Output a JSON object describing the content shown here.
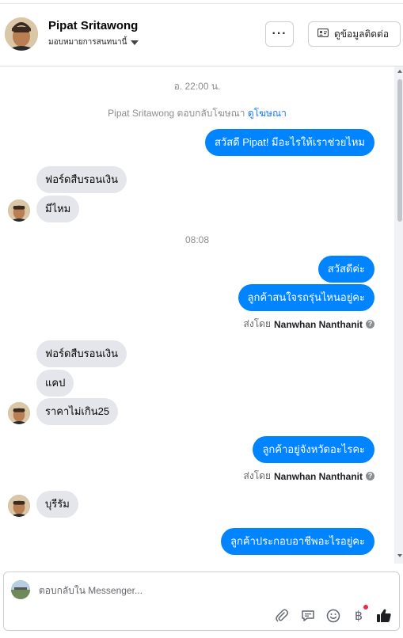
{
  "header": {
    "contact_name": "Pipat Sritawong",
    "assign_label": "มอบหมายการสนทนานี้",
    "more_label": "···",
    "contact_info_label": "ดูข้อมูลติดต่อ"
  },
  "thread": {
    "timestamp_1": "อ. 22:00 น.",
    "ad_reply_text": "Pipat Sritawong ตอบกลับโฆษณา",
    "view_ad_link": "ดูโฆษณา",
    "msg_out_1": "สวัสดี Pipat! มีอะไรให้เราช่วยไหม",
    "msg_in_1": "ฟอร์ดสืบรอนเงิน",
    "msg_in_2": "มีไหม",
    "timestamp_2": "08:08",
    "msg_out_2": "สวัสดีค่ะ",
    "msg_out_3": "ลูกค้าสนใจรถรุ่นไหนอยู่คะ",
    "sent_by_label": "ส่งโดย",
    "sent_by_name": "Nanwhan Nanthanit",
    "msg_in_3": "ฟอร์ดสืบรอนเงิน",
    "msg_in_4": "แคป",
    "msg_in_5": "ราคาไม่เกิน25",
    "msg_out_4": "ลูกค้าอยู่จังหวัดอะไรคะ",
    "msg_in_6": "บุรีรัม",
    "msg_out_5": "ลูกค้าประกอบอาชีพอะไรอยู่คะ"
  },
  "composer": {
    "placeholder": "ตอบกลับใน Messenger..."
  },
  "colors": {
    "outgoing_bubble": "#0084ff",
    "incoming_bubble": "#e4e6eb",
    "link": "#1877f2",
    "like_icon": "#1c1e21"
  },
  "icons": [
    "chevron-down-icon",
    "more-icon",
    "contact-card-icon",
    "help-icon",
    "attachment-icon",
    "saved-reply-icon",
    "emoji-icon",
    "baht-icon",
    "thumbs-up-icon"
  ]
}
